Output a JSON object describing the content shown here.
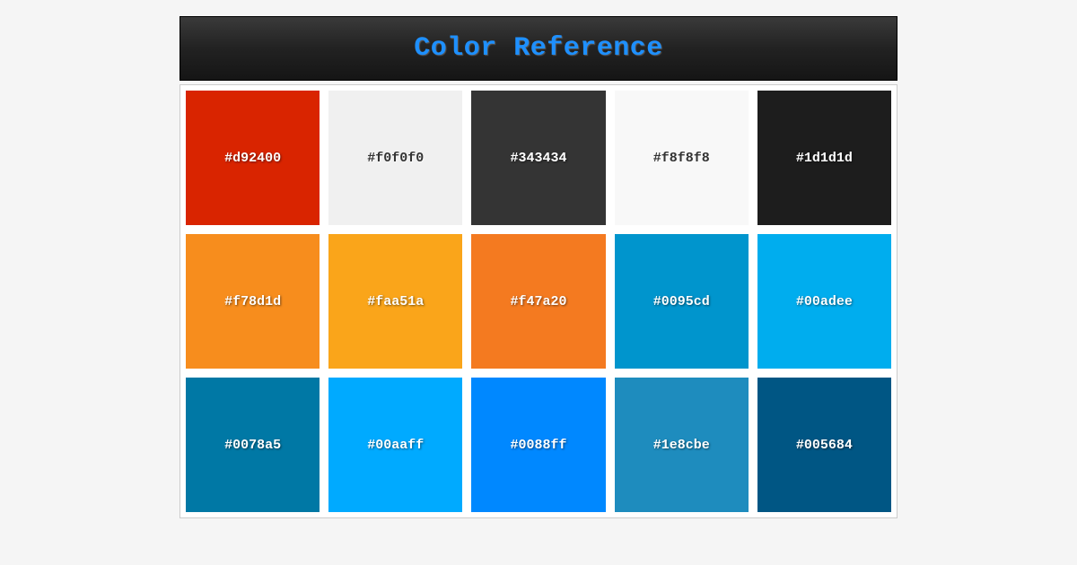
{
  "title": "Color Reference",
  "swatches": [
    {
      "hex": "#d92400",
      "text_color": "#ffffff"
    },
    {
      "hex": "#f0f0f0",
      "text_color": "#333333"
    },
    {
      "hex": "#343434",
      "text_color": "#ffffff"
    },
    {
      "hex": "#f8f8f8",
      "text_color": "#333333"
    },
    {
      "hex": "#1d1d1d",
      "text_color": "#ffffff"
    },
    {
      "hex": "#f78d1d",
      "text_color": "#ffffff"
    },
    {
      "hex": "#faa51a",
      "text_color": "#ffffff"
    },
    {
      "hex": "#f47a20",
      "text_color": "#ffffff"
    },
    {
      "hex": "#0095cd",
      "text_color": "#ffffff"
    },
    {
      "hex": "#00adee",
      "text_color": "#ffffff"
    },
    {
      "hex": "#0078a5",
      "text_color": "#ffffff"
    },
    {
      "hex": "#00aaff",
      "text_color": "#ffffff"
    },
    {
      "hex": "#0088ff",
      "text_color": "#ffffff"
    },
    {
      "hex": "#1e8cbe",
      "text_color": "#ffffff"
    },
    {
      "hex": "#005684",
      "text_color": "#ffffff"
    }
  ]
}
